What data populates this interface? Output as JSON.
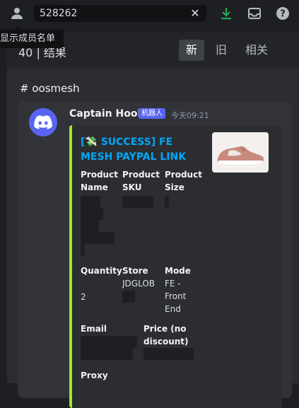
{
  "search": {
    "query": "528262"
  },
  "tooltip": "显示成员名单",
  "results": {
    "count_label": "40 | 结果",
    "sort_new": "新",
    "sort_old": "旧",
    "sort_relevant": "相关"
  },
  "channel": {
    "name": "# oosmesh"
  },
  "message": {
    "author": "Captain Hook",
    "badge": "机器人",
    "time": "今天09:21",
    "embed": {
      "accent_color": "#9be92c",
      "title": "[💸 SUCCESS] FE MESH PAYPAL LINK",
      "fields": {
        "product_name": "Product Name",
        "product_sku": "Product SKU",
        "product_size": "Product Size",
        "quantity": "Quantity",
        "quantity_value": "2",
        "store": "Store",
        "store_value": "JDGLOB",
        "mode": "Mode",
        "mode_value": "FE - Front End",
        "email": "Email",
        "price": "Price (no discount)",
        "proxy": "Proxy"
      }
    }
  },
  "icons": {
    "members": "members-icon",
    "download": "download-icon",
    "inbox": "inbox-icon",
    "help": "help-icon",
    "discord": "discord-icon"
  }
}
